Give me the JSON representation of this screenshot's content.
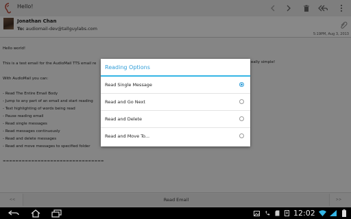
{
  "actionbar": {
    "subject": "Hello!",
    "icons": [
      "app-icon",
      "prev-arrow-icon",
      "next-arrow-icon",
      "delete-icon",
      "reply-all-icon",
      "overflow-menu-icon"
    ]
  },
  "message": {
    "sender": "Jonathan Chan",
    "to_label": "To:",
    "to_value": "audiomail-dev@tallguylabs.com",
    "date": "5:19PM, Aug 3, 2013"
  },
  "body_lines": [
    "Hello world!",
    "",
    "This is a test email for the AudioMail TTS email re",
    "",
    "With AudioMail you can:",
    "",
    "- Read The Entire Email Body",
    "- Jump to any part of an email and start reading",
    "- Text highlighting of words being read",
    "- Pause reading email",
    "- Read single messages",
    "- Read messages continuously",
    "- Read and delete messages",
    "- Read and move messages to specified folder",
    "",
    "================================"
  ],
  "body_tail": "eally simple!",
  "bottom": {
    "read_label": "Read Email",
    "left_btn": "<<",
    "right_btn": ">>"
  },
  "dialog": {
    "title": "Reading Options",
    "options": [
      {
        "label": "Read Single Message",
        "selected": true
      },
      {
        "label": "Read and Go Next",
        "selected": false
      },
      {
        "label": "Read and Delete",
        "selected": false
      },
      {
        "label": "Read and Move To...",
        "selected": false
      }
    ]
  },
  "system": {
    "time": "12:02",
    "icons": [
      "back-icon",
      "home-icon",
      "recent-apps-icon",
      "screenshot-icon",
      "phone-icon",
      "sd-card-icon",
      "file-icon",
      "wifi-icon",
      "battery-icon"
    ]
  },
  "colors": {
    "accent": "#33b5e5"
  }
}
